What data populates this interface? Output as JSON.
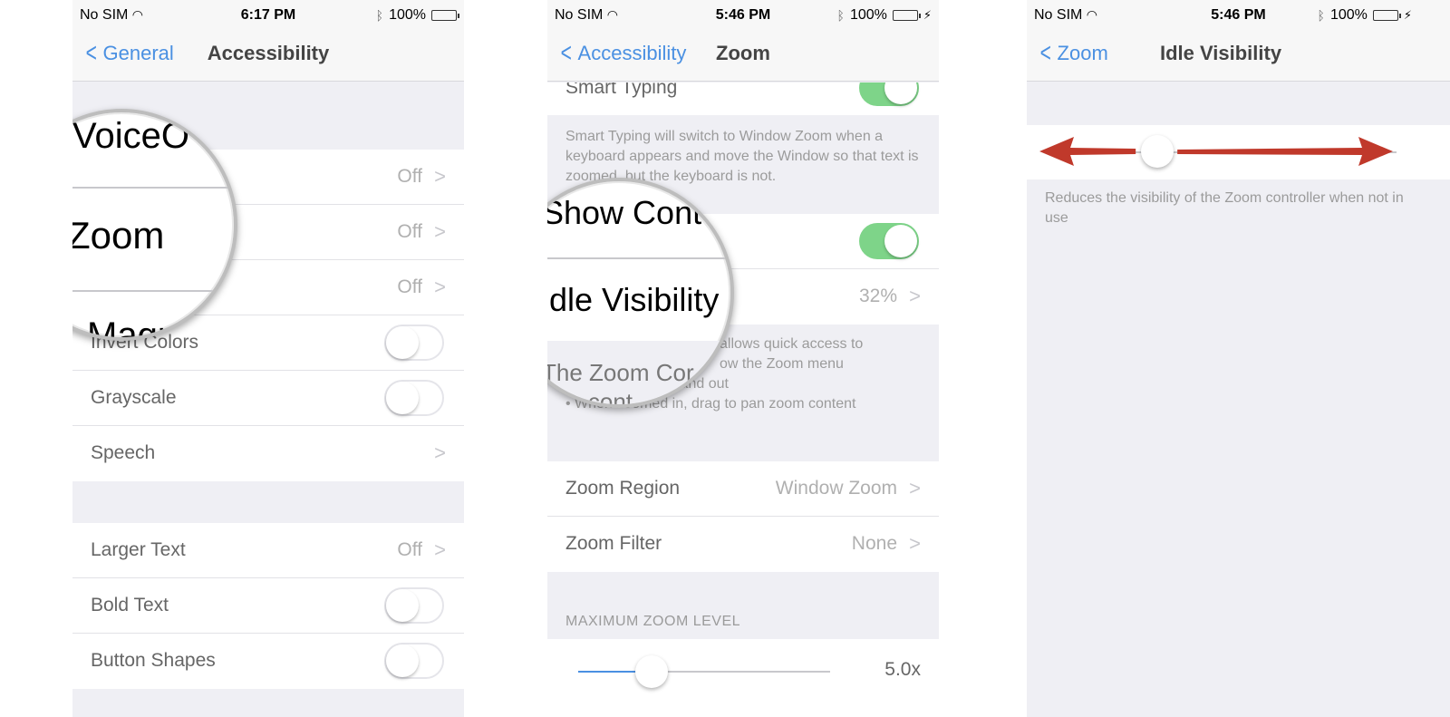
{
  "panel1": {
    "status": {
      "carrier": "No SIM",
      "time": "6:17 PM",
      "battery": "100%"
    },
    "nav": {
      "back": "General",
      "title": "Accessibility"
    },
    "rows_group1": [
      {
        "label": "",
        "value": "Off"
      },
      {
        "label": "",
        "value": "Off"
      },
      {
        "label": "",
        "value": "Off"
      },
      {
        "label": "Invert Colors"
      },
      {
        "label": "Grayscale"
      },
      {
        "label": "Speech"
      }
    ],
    "rows_group2": [
      {
        "label": "Larger Text",
        "value": "Off"
      },
      {
        "label": "Bold Text"
      },
      {
        "label": "Button Shapes"
      }
    ],
    "magnifier": {
      "top_text": "VoiceO",
      "main_text": "Zoom",
      "bottom_text": "Magni"
    }
  },
  "panel2": {
    "status": {
      "carrier": "No SIM",
      "time": "5:46 PM",
      "battery": "100%"
    },
    "nav": {
      "back": "Accessibility",
      "title": "Zoom"
    },
    "smart_typing": {
      "label": "Smart Typing"
    },
    "smart_typing_footer": "Smart Typing will switch to Window Zoom when a keyboard appears and move the Window so that text is zoomed, but the keyboard is not.",
    "idle_row": {
      "value": "32%"
    },
    "controller_footer_lines": [
      "allows quick access to",
      "ow the Zoom menu",
      "• D       ap to zoom in and out",
      "• When zoomed in, drag to pan zoom content"
    ],
    "zoom_region": {
      "label": "Zoom Region",
      "value": "Window Zoom"
    },
    "zoom_filter": {
      "label": "Zoom Filter",
      "value": "None"
    },
    "max_zoom_header": "MAXIMUM ZOOM LEVEL",
    "max_zoom": {
      "value_label": "5.0x",
      "level": 0.29
    },
    "magnifier": {
      "top_text": "Show Cont",
      "main_text": "Idle Visibility",
      "bottom_text": "The Zoom Cor",
      "bottom_text2": "m cont"
    }
  },
  "panel3": {
    "status": {
      "carrier": "No SIM",
      "time": "5:46 PM",
      "battery": "100%"
    },
    "nav": {
      "back": "Zoom",
      "title": "Idle Visibility"
    },
    "footer": "Reduces the visibility of the Zoom controller when not in use",
    "slider": {
      "level": 0.32
    },
    "arrow_color": "#c0392b"
  },
  "colors": {
    "accent": "#4a90e2",
    "toggle_on": "#7ed489",
    "battery_green": "#4cd964"
  }
}
